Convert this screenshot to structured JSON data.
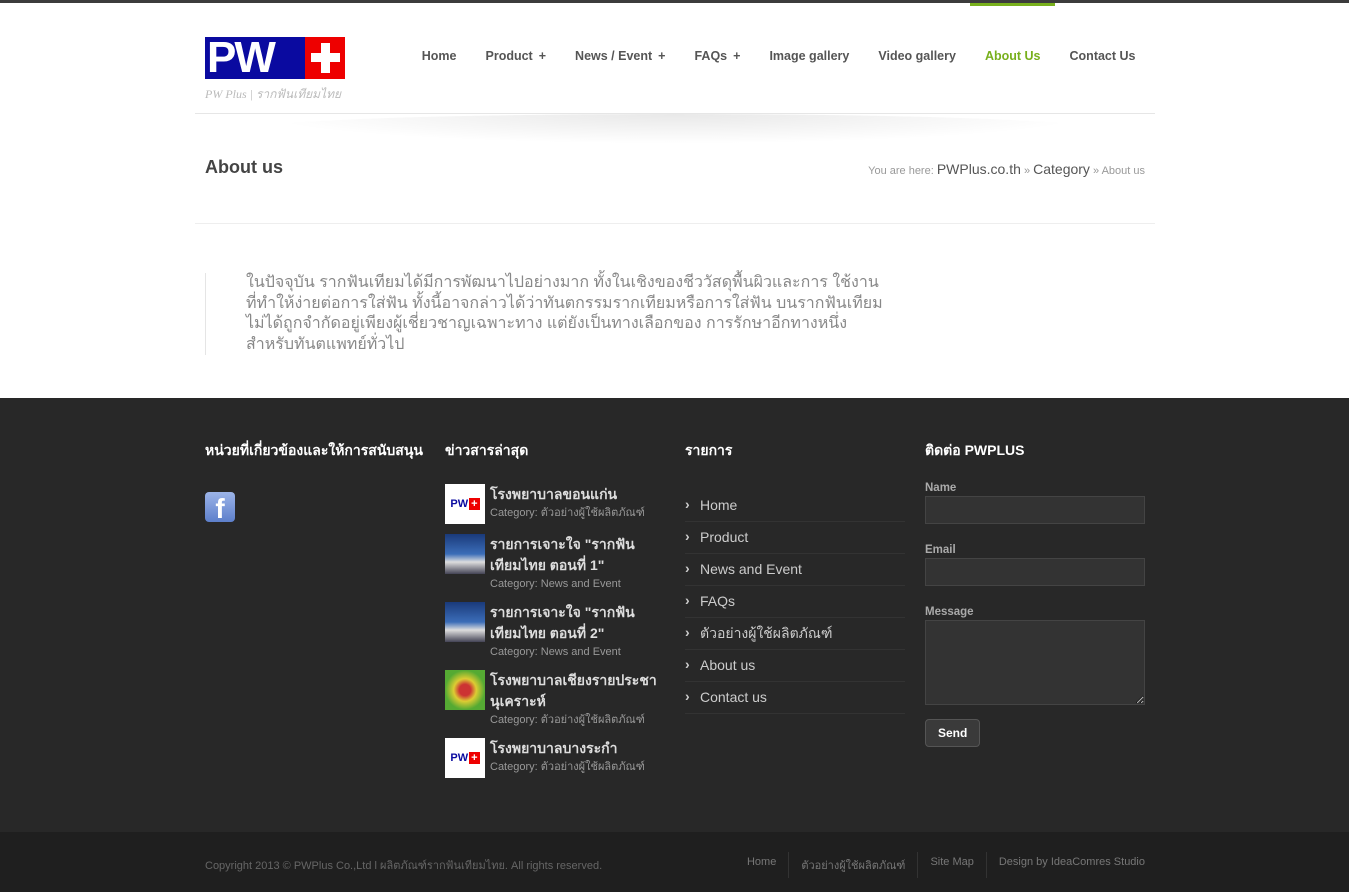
{
  "header": {
    "logo_text": "PW",
    "tagline": "PW Plus | รากฟันเทียมไทย",
    "nav": [
      {
        "label": "Home",
        "plus": ""
      },
      {
        "label": "Product",
        "plus": "+"
      },
      {
        "label": "News / Event",
        "plus": "+"
      },
      {
        "label": "FAQs",
        "plus": "+"
      },
      {
        "label": "Image gallery",
        "plus": ""
      },
      {
        "label": "Video gallery",
        "plus": ""
      },
      {
        "label": "About Us",
        "plus": "",
        "active": true
      },
      {
        "label": "Contact Us",
        "plus": ""
      }
    ],
    "accent": "#78b01c"
  },
  "page": {
    "title": "About us",
    "breadcrumb": {
      "prefix": "You are here:",
      "home": "PWPlus.co.th",
      "sep": "»",
      "category": "Category",
      "current": "About us"
    },
    "content": "ในปัจจุบัน รากฟันเทียมได้มีการพัฒนาไปอย่างมาก ทั้งในเชิงของชีววัสดุพื้นผิวและการ ใช้งานที่ทำให้ง่ายต่อการใส่ฟัน ทั้งนี้อาจกล่าวได้ว่าทันตกรรมรากเทียมหรือการใส่ฟัน บนรากฟันเทียม ไม่ได้ถูกจำกัดอยู่เพียงผู้เชี่ยวชาญเฉพาะทาง แต่ยังเป็นทางเลือกของ การรักษาอีกทางหนึ่งสำหรับทันตแพทย์ทั่วไป"
  },
  "footer": {
    "col1": {
      "title": "หน่วยที่เกี่ยวข้องและให้การสนับสนุน",
      "icon": "facebook-icon"
    },
    "col2": {
      "title": "ข่าวสารล่าสุด",
      "items": [
        {
          "title": "โรงพยาบาลขอนแก่น",
          "category": "Category: ตัวอย่างผู้ใช้ผลิตภัณฑ์",
          "thumb": "pw"
        },
        {
          "title": "รายการเจาะใจ \"รากฟันเทียมไทย ตอนที่ 1\"",
          "category": "Category: News and Event",
          "thumb": "tv"
        },
        {
          "title": "รายการเจาะใจ \"รากฟันเทียมไทย ตอนที่ 2\"",
          "category": "Category: News and Event",
          "thumb": "tv"
        },
        {
          "title": "โรงพยาบาลเชียงรายประชานุเคราะห์",
          "category": "Category: ตัวอย่างผู้ใช้ผลิตภัณฑ์",
          "thumb": "emb"
        },
        {
          "title": "โรงพยาบาลบางระกำ",
          "category": "Category: ตัวอย่างผู้ใช้ผลิตภัณฑ์",
          "thumb": "pw"
        }
      ]
    },
    "col3": {
      "title": "รายการ",
      "items": [
        "Home",
        "Product",
        "News and Event",
        "FAQs",
        "ตัวอย่างผู้ใช้ผลิตภัณฑ์",
        "About us",
        "Contact us"
      ]
    },
    "col4": {
      "title": "ติดต่อ PWPLUS",
      "name_label": "Name",
      "email_label": "Email",
      "message_label": "Message",
      "send_label": "Send"
    }
  },
  "bottom": {
    "copyright": "Copyright 2013 © PWPlus Co.,Ltd l ผลิตภัณฑ์รากฟันเทียมไทย. All rights reserved.",
    "links": [
      "Home",
      "ตัวอย่างผู้ใช้ผลิตภัณฑ์",
      "Site Map",
      "Design by IdeaComres Studio"
    ]
  }
}
